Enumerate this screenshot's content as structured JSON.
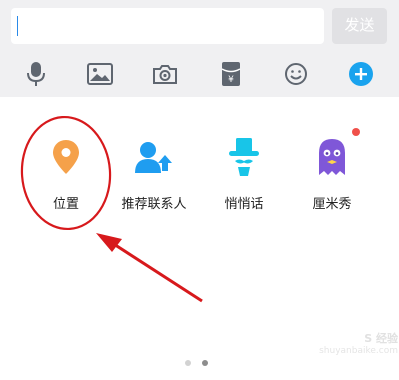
{
  "input": {
    "value": "",
    "placeholder": ""
  },
  "send_button": {
    "label": "发送"
  },
  "toolbar": {
    "icons": [
      "microphone-icon",
      "image-icon",
      "camera-icon",
      "red-packet-icon",
      "emoji-icon",
      "plus-icon"
    ],
    "accent_color": "#1aa3ee",
    "icon_color": "#5f6670"
  },
  "apps": [
    {
      "label": "位置",
      "icon": "location-pin-icon",
      "color": "#f5a14a"
    },
    {
      "label": "推荐联系人",
      "icon": "recommend-contact-icon",
      "color": "#1f9df0"
    },
    {
      "label": "悄悄话",
      "icon": "whisper-hat-icon",
      "color": "#18c5e8"
    },
    {
      "label": "厘米秀",
      "icon": "cmshow-icon",
      "color": "#7f57d8"
    }
  ],
  "badge_color": "#f0504a",
  "pagination": {
    "pages": 2,
    "active": 2
  },
  "annotation": {
    "highlight": "location",
    "color": "#d7191c"
  },
  "watermark": {
    "logo": "S 经验",
    "url": "shuyanbaike.com"
  }
}
